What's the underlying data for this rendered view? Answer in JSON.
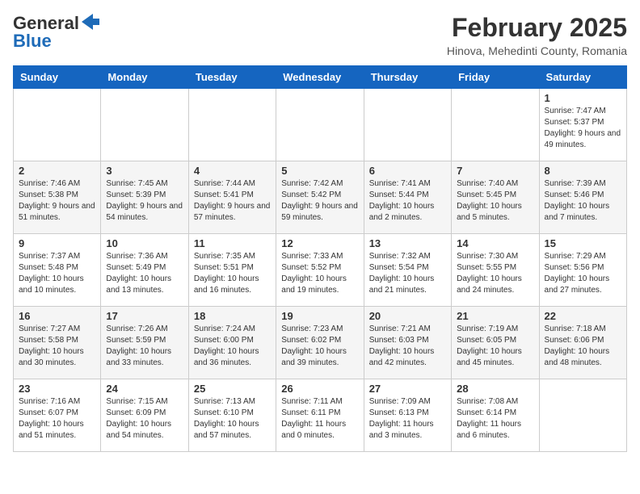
{
  "header": {
    "logo_line1": "General",
    "logo_line2": "Blue",
    "month_year": "February 2025",
    "location": "Hinova, Mehedinti County, Romania"
  },
  "weekdays": [
    "Sunday",
    "Monday",
    "Tuesday",
    "Wednesday",
    "Thursday",
    "Friday",
    "Saturday"
  ],
  "weeks": [
    [
      {
        "day": "",
        "info": ""
      },
      {
        "day": "",
        "info": ""
      },
      {
        "day": "",
        "info": ""
      },
      {
        "day": "",
        "info": ""
      },
      {
        "day": "",
        "info": ""
      },
      {
        "day": "",
        "info": ""
      },
      {
        "day": "1",
        "info": "Sunrise: 7:47 AM\nSunset: 5:37 PM\nDaylight: 9 hours and 49 minutes."
      }
    ],
    [
      {
        "day": "2",
        "info": "Sunrise: 7:46 AM\nSunset: 5:38 PM\nDaylight: 9 hours and 51 minutes."
      },
      {
        "day": "3",
        "info": "Sunrise: 7:45 AM\nSunset: 5:39 PM\nDaylight: 9 hours and 54 minutes."
      },
      {
        "day": "4",
        "info": "Sunrise: 7:44 AM\nSunset: 5:41 PM\nDaylight: 9 hours and 57 minutes."
      },
      {
        "day": "5",
        "info": "Sunrise: 7:42 AM\nSunset: 5:42 PM\nDaylight: 9 hours and 59 minutes."
      },
      {
        "day": "6",
        "info": "Sunrise: 7:41 AM\nSunset: 5:44 PM\nDaylight: 10 hours and 2 minutes."
      },
      {
        "day": "7",
        "info": "Sunrise: 7:40 AM\nSunset: 5:45 PM\nDaylight: 10 hours and 5 minutes."
      },
      {
        "day": "8",
        "info": "Sunrise: 7:39 AM\nSunset: 5:46 PM\nDaylight: 10 hours and 7 minutes."
      }
    ],
    [
      {
        "day": "9",
        "info": "Sunrise: 7:37 AM\nSunset: 5:48 PM\nDaylight: 10 hours and 10 minutes."
      },
      {
        "day": "10",
        "info": "Sunrise: 7:36 AM\nSunset: 5:49 PM\nDaylight: 10 hours and 13 minutes."
      },
      {
        "day": "11",
        "info": "Sunrise: 7:35 AM\nSunset: 5:51 PM\nDaylight: 10 hours and 16 minutes."
      },
      {
        "day": "12",
        "info": "Sunrise: 7:33 AM\nSunset: 5:52 PM\nDaylight: 10 hours and 19 minutes."
      },
      {
        "day": "13",
        "info": "Sunrise: 7:32 AM\nSunset: 5:54 PM\nDaylight: 10 hours and 21 minutes."
      },
      {
        "day": "14",
        "info": "Sunrise: 7:30 AM\nSunset: 5:55 PM\nDaylight: 10 hours and 24 minutes."
      },
      {
        "day": "15",
        "info": "Sunrise: 7:29 AM\nSunset: 5:56 PM\nDaylight: 10 hours and 27 minutes."
      }
    ],
    [
      {
        "day": "16",
        "info": "Sunrise: 7:27 AM\nSunset: 5:58 PM\nDaylight: 10 hours and 30 minutes."
      },
      {
        "day": "17",
        "info": "Sunrise: 7:26 AM\nSunset: 5:59 PM\nDaylight: 10 hours and 33 minutes."
      },
      {
        "day": "18",
        "info": "Sunrise: 7:24 AM\nSunset: 6:00 PM\nDaylight: 10 hours and 36 minutes."
      },
      {
        "day": "19",
        "info": "Sunrise: 7:23 AM\nSunset: 6:02 PM\nDaylight: 10 hours and 39 minutes."
      },
      {
        "day": "20",
        "info": "Sunrise: 7:21 AM\nSunset: 6:03 PM\nDaylight: 10 hours and 42 minutes."
      },
      {
        "day": "21",
        "info": "Sunrise: 7:19 AM\nSunset: 6:05 PM\nDaylight: 10 hours and 45 minutes."
      },
      {
        "day": "22",
        "info": "Sunrise: 7:18 AM\nSunset: 6:06 PM\nDaylight: 10 hours and 48 minutes."
      }
    ],
    [
      {
        "day": "23",
        "info": "Sunrise: 7:16 AM\nSunset: 6:07 PM\nDaylight: 10 hours and 51 minutes."
      },
      {
        "day": "24",
        "info": "Sunrise: 7:15 AM\nSunset: 6:09 PM\nDaylight: 10 hours and 54 minutes."
      },
      {
        "day": "25",
        "info": "Sunrise: 7:13 AM\nSunset: 6:10 PM\nDaylight: 10 hours and 57 minutes."
      },
      {
        "day": "26",
        "info": "Sunrise: 7:11 AM\nSunset: 6:11 PM\nDaylight: 11 hours and 0 minutes."
      },
      {
        "day": "27",
        "info": "Sunrise: 7:09 AM\nSunset: 6:13 PM\nDaylight: 11 hours and 3 minutes."
      },
      {
        "day": "28",
        "info": "Sunrise: 7:08 AM\nSunset: 6:14 PM\nDaylight: 11 hours and 6 minutes."
      },
      {
        "day": "",
        "info": ""
      }
    ]
  ]
}
